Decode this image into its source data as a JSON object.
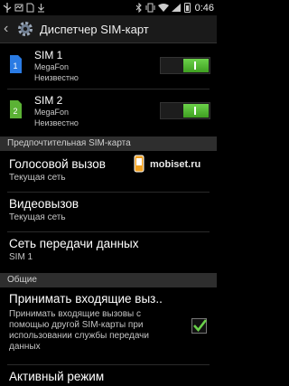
{
  "status_bar": {
    "time": "0:46",
    "left_icons": [
      "usb-icon",
      "notification-icon",
      "sd-card-icon",
      "download-icon"
    ],
    "right_icons": [
      "bluetooth-icon",
      "vibrate-icon",
      "wifi-icon",
      "signal-icon",
      "battery-icon"
    ]
  },
  "action_bar": {
    "title": "Диспетчер SIM-карт",
    "icon": "settings-gear-icon"
  },
  "sims": [
    {
      "name": "SIM 1",
      "operator": "MegaFon",
      "state": "Неизвестно",
      "badge": "1",
      "badge_color": "#2a7be4",
      "enabled": true
    },
    {
      "name": "SIM 2",
      "operator": "MegaFon",
      "state": "Неизвестно",
      "badge": "2",
      "badge_color": "#5bb235",
      "enabled": true
    }
  ],
  "preferred": {
    "header": "Предпочтительная SIM-карта",
    "items": [
      {
        "title": "Голосовой вызов",
        "subtitle": "Текущая сеть"
      },
      {
        "title": "Видеовызов",
        "subtitle": "Текущая сеть"
      },
      {
        "title": "Сеть передачи данных",
        "subtitle": "SIM 1"
      }
    ]
  },
  "general": {
    "header": "Общие",
    "accept_calls": {
      "title": "Принимать входящие выз..",
      "description": "Принимать входящие вызовы с помощью другой SIM-карты при использовании службы передачи данных",
      "checked": true
    },
    "active_mode": {
      "title": "Активный режим"
    }
  },
  "watermark": {
    "text": "mobiset.ru"
  },
  "colors": {
    "toggle_on": "#4cb52d",
    "section_header_bg": "#2e2e2e",
    "checkmark": "#6ad14a"
  }
}
